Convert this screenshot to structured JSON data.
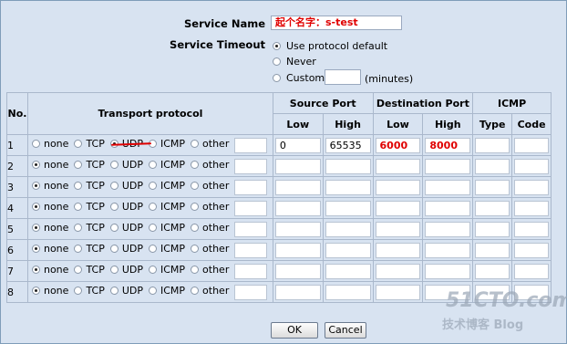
{
  "service": {
    "name_label": "Service Name",
    "name_value": "起个名字：s-test",
    "timeout_label": "Service Timeout",
    "timeout_options": [
      {
        "label": "Use protocol default",
        "selected": true
      },
      {
        "label": "Never",
        "selected": false
      },
      {
        "label": "Custom",
        "selected": false
      }
    ],
    "custom_unit": "(minutes)"
  },
  "table": {
    "headers": {
      "no": "No.",
      "transport": "Transport protocol",
      "source_port": "Source Port",
      "dest_port": "Destination Port",
      "icmp": "ICMP",
      "low": "Low",
      "high": "High",
      "type": "Type",
      "code": "Code"
    },
    "protocol_options": [
      "none",
      "TCP",
      "UDP",
      "ICMP",
      "other"
    ],
    "rows": [
      {
        "no": "1",
        "selected": "UDP",
        "src_low": "0",
        "src_high": "65535",
        "dst_low": "6000",
        "dst_high": "8000"
      },
      {
        "no": "2",
        "selected": "none",
        "src_low": "",
        "src_high": "",
        "dst_low": "",
        "dst_high": ""
      },
      {
        "no": "3",
        "selected": "none",
        "src_low": "",
        "src_high": "",
        "dst_low": "",
        "dst_high": ""
      },
      {
        "no": "4",
        "selected": "none",
        "src_low": "",
        "src_high": "",
        "dst_low": "",
        "dst_high": ""
      },
      {
        "no": "5",
        "selected": "none",
        "src_low": "",
        "src_high": "",
        "dst_low": "",
        "dst_high": ""
      },
      {
        "no": "6",
        "selected": "none",
        "src_low": "",
        "src_high": "",
        "dst_low": "",
        "dst_high": ""
      },
      {
        "no": "7",
        "selected": "none",
        "src_low": "",
        "src_high": "",
        "dst_low": "",
        "dst_high": ""
      },
      {
        "no": "8",
        "selected": "none",
        "src_low": "",
        "src_high": "",
        "dst_low": "",
        "dst_high": ""
      }
    ]
  },
  "buttons": {
    "ok": "OK",
    "cancel": "Cancel"
  },
  "watermark": {
    "line1": "51CTO.com",
    "line2": "技术博客 Blog"
  },
  "colors": {
    "background": "#d8e3f1",
    "highlight": "#e00000"
  }
}
